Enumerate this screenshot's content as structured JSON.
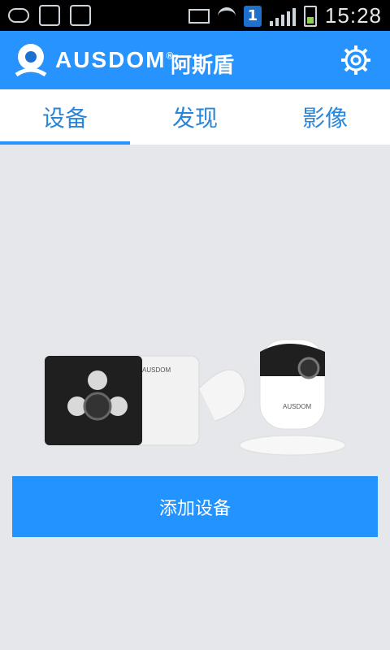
{
  "status_bar": {
    "time": "15:28",
    "notification_badge": "1"
  },
  "header": {
    "brand_name": "AUSDOM",
    "brand_registered": "®",
    "brand_chinese": "阿斯盾"
  },
  "tabs": [
    {
      "label": "设备",
      "active": true
    },
    {
      "label": "发现",
      "active": false
    },
    {
      "label": "影像",
      "active": false
    }
  ],
  "main": {
    "camera_brand_text": "AUSDOM",
    "add_device_button": "添加设备"
  },
  "colors": {
    "header_bg": "#2693ff",
    "tab_text": "#2a86d8",
    "button_bg": "#2393ff",
    "content_bg": "#e6e7eb"
  }
}
